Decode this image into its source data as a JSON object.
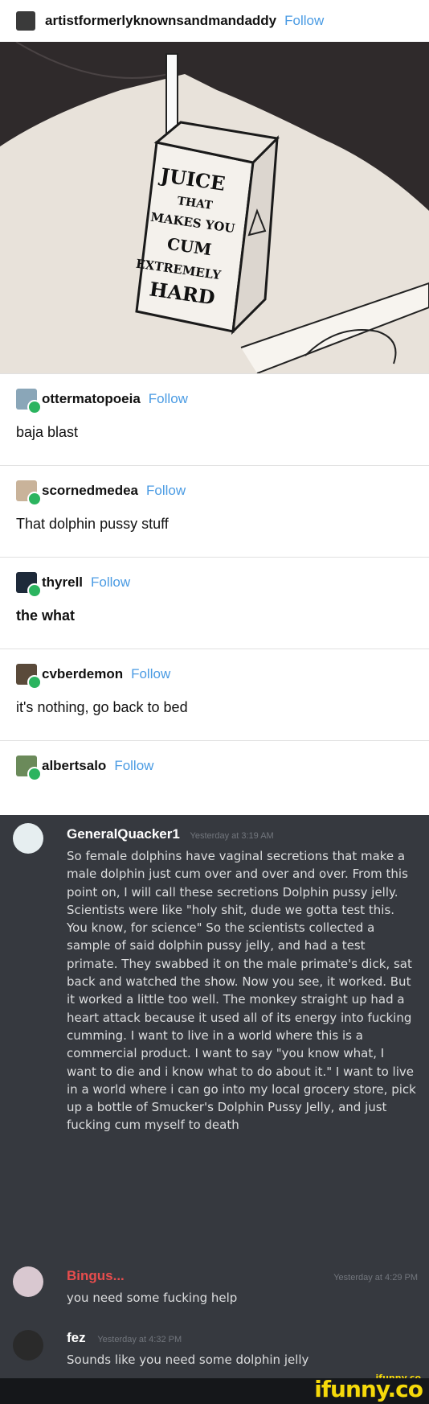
{
  "op": {
    "username": "artistformerlyknownsandmandaddy",
    "follow_label": "Follow"
  },
  "comic": {
    "juice_text": [
      "JUICE",
      "THAT",
      "MAKES YOU",
      "CUM",
      "EXTREMELY",
      "HARD"
    ]
  },
  "reblogs": [
    {
      "username": "ottermatopoeia",
      "follow_label": "Follow",
      "text": "baja blast",
      "bold": false
    },
    {
      "username": "scornedmedea",
      "follow_label": "Follow",
      "text": "That dolphin pussy stuff",
      "bold": false
    },
    {
      "username": "thyrell",
      "follow_label": "Follow",
      "text": "the what",
      "bold": true
    },
    {
      "username": "cvberdemon",
      "follow_label": "Follow",
      "text": "it's nothing, go back to bed",
      "bold": false
    },
    {
      "username": "albertsalo",
      "follow_label": "Follow",
      "text": "",
      "bold": false
    }
  ],
  "discord": {
    "messages": [
      {
        "author": "GeneralQuacker1",
        "timestamp": "Yesterday at 3:19 AM",
        "author_color": "#ffffff",
        "text": "So female dolphins have vaginal secretions that make a male dolphin just cum over and over and over. From this point on, I will call these secretions Dolphin pussy jelly. Scientists were like \"holy shit, dude we gotta test this. You know, for science\" So the scientists collected a sample of said dolphin pussy jelly, and had a test primate. They swabbed it on the male primate's dick, sat back and watched the show. Now you see, it worked. But it worked a little too well. The monkey straight up had a heart attack because it used all of its energy into fucking cumming. I want to live in a world where this is a commercial product. I want to say \"you know what, I want to die and i know what to do about it.\" I want to live in a world where i can go into my local grocery store, pick up a bottle of Smucker's Dolphin Pussy Jelly, and just fucking cum myself to death"
      },
      {
        "author": "Bingus...",
        "timestamp": "Yesterday at 4:29 PM",
        "author_color": "#e84d4d",
        "text": "you need some fucking help"
      },
      {
        "author": "fez",
        "timestamp": "Yesterday at 4:32 PM",
        "author_color": "#ffffff",
        "text": "Sounds like you need some dolphin jelly"
      }
    ]
  },
  "watermark": {
    "small": "ifunny.co",
    "large": "ifunny.co"
  }
}
